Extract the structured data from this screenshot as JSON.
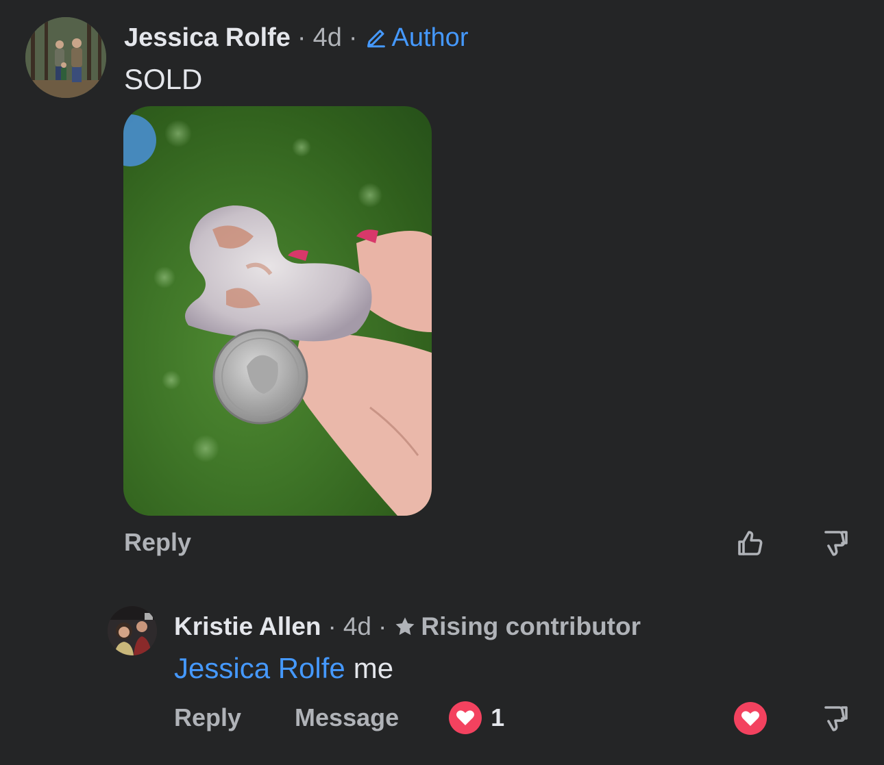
{
  "comment": {
    "author": "Jessica Rolfe",
    "separator": "·",
    "time": "4d",
    "badge": "Author",
    "text": "SOLD",
    "reply_label": "Reply",
    "badge_icon": "pencil-icon",
    "like_icon": "thumbs-up-icon",
    "dislike_icon": "thumbs-down-icon"
  },
  "reply": {
    "author": "Kristie Allen",
    "separator": "·",
    "time": "4d",
    "badge": "Rising contributor",
    "badge_icon": "star-icon",
    "mention": "Jessica Rolfe",
    "text": "me",
    "reply_label": "Reply",
    "message_label": "Message",
    "reaction_count": "1",
    "reaction_icon": "heart-icon"
  },
  "colors": {
    "background": "#242526",
    "link_blue": "#4599ff",
    "muted": "#b0b3b8",
    "heart_red": "#f3425f"
  }
}
